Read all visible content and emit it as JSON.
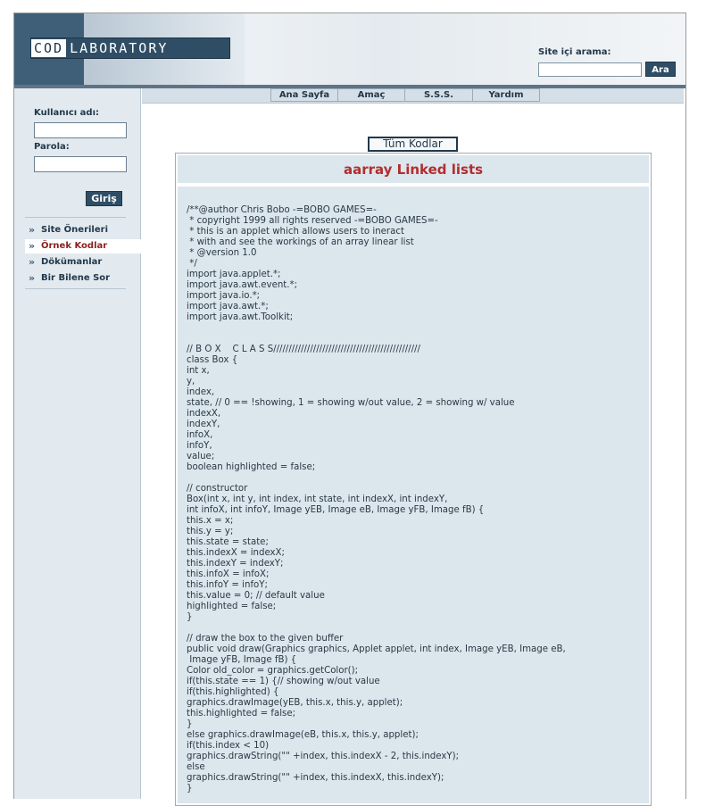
{
  "header": {
    "logo_left": "COD",
    "logo_right": "LABORATORY",
    "search_label": "Site içi arama:",
    "search_value": "",
    "search_button": "Ara"
  },
  "sidebar": {
    "username_label": "Kullanıcı adı:",
    "password_label": "Parola:",
    "login_button": "Giriş",
    "items": [
      {
        "label": "Site Önerileri",
        "active": false
      },
      {
        "label": "Örnek Kodlar",
        "active": true
      },
      {
        "label": "Dökümanlar",
        "active": false
      },
      {
        "label": "Bir Bilene Sor",
        "active": false
      }
    ],
    "arrow": "»"
  },
  "topnav": [
    {
      "label": "Ana Sayfa"
    },
    {
      "label": "Amaç"
    },
    {
      "label": "S.S.S."
    },
    {
      "label": "Yardım"
    }
  ],
  "main": {
    "all_button": "Tüm Kodlar",
    "title": "aarray Linked lists",
    "code": "/**@author Chris Bobo -=BOBO GAMES=-\n * copyright 1999 all rights reserved -=BOBO GAMES=-\n * this is an applet which allows users to ineract\n * with and see the workings of an array linear list\n * @version 1.0\n */\nimport java.applet.*;\nimport java.awt.event.*;\nimport java.io.*;\nimport java.awt.*;\nimport java.awt.Toolkit;\n\n\n// B O X    C L A S S////////////////////////////////////////////////\nclass Box {\nint x,\ny,\nindex,\nstate, // 0 == !showing, 1 = showing w/out value, 2 = showing w/ value\nindexX,\nindexY,\ninfoX,\ninfoY,\nvalue;\nboolean highlighted = false;\n\n// constructor\nBox(int x, int y, int index, int state, int indexX, int indexY,\nint infoX, int infoY, Image yEB, Image eB, Image yFB, Image fB) {\nthis.x = x;\nthis.y = y;\nthis.state = state;\nthis.indexX = indexX;\nthis.indexY = indexY;\nthis.infoX = infoX;\nthis.infoY = infoY;\nthis.value = 0; // default value\nhighlighted = false;\n}\n\n// draw the box to the given buffer\npublic void draw(Graphics graphics, Applet applet, int index, Image yEB, Image eB,\n Image yFB, Image fB) {\nColor old_color = graphics.getColor();\nif(this.state == 1) {// showing w/out value\nif(this.highlighted) {\ngraphics.drawImage(yEB, this.x, this.y, applet);\nthis.highlighted = false;\n}\nelse graphics.drawImage(eB, this.x, this.y, applet);\nif(this.index < 10)\ngraphics.drawString(\"\" +index, this.indexX - 2, this.indexY);\nelse\ngraphics.drawString(\"\" +index, this.indexX, this.indexY);\n}"
  }
}
